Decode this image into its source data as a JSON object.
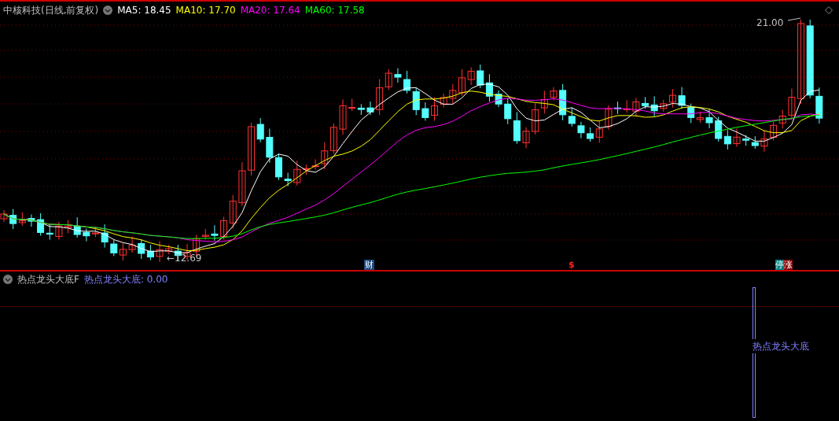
{
  "header": {
    "title": "中核科技(日线,前复权)",
    "ma": [
      {
        "label": "MA5: 18.45",
        "color": "#ffffff"
      },
      {
        "label": "MA10: 17.70",
        "color": "#ffff00"
      },
      {
        "label": "MA20: 17.64",
        "color": "#ff00ff"
      },
      {
        "label": "MA60: 17.58",
        "color": "#00ff00"
      }
    ]
  },
  "chart": {
    "high_label": "21.00",
    "low_label": "←12.69",
    "markers": [
      {
        "kind": "finance",
        "text": "财"
      },
      {
        "kind": "dividend",
        "text": "$"
      },
      {
        "kind": "limit",
        "parts": [
          {
            "text": "停",
            "color": "#008080"
          },
          {
            "text": "涨",
            "color": "#8b0000"
          }
        ]
      }
    ]
  },
  "indicator": {
    "name": "热点龙头大底F",
    "value_label": "热点龙头大底: 0.00",
    "signal_label": "热点龙头大底"
  }
}
